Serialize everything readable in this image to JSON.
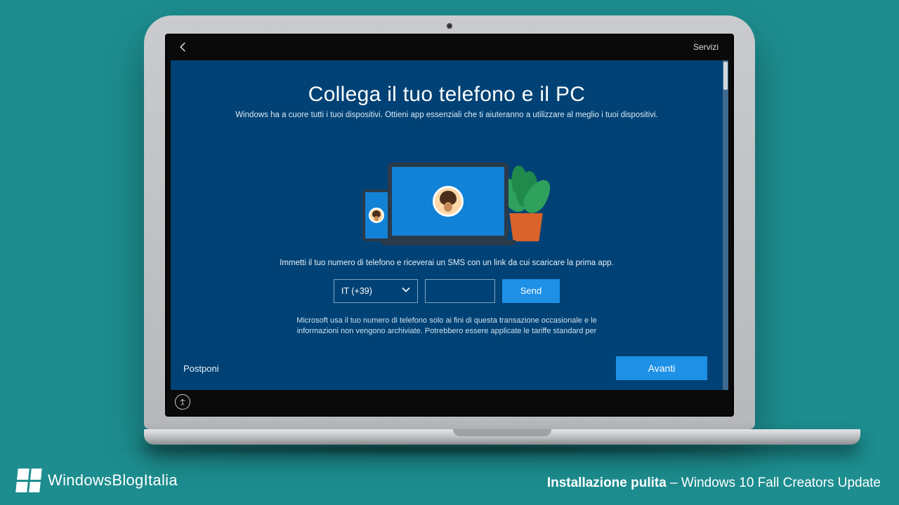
{
  "topbar": {
    "services": "Servizi"
  },
  "oobe": {
    "title": "Collega il tuo telefono e il PC",
    "subtitle": "Windows ha a cuore tutti i tuoi dispositivi. Ottieni app essenziali che ti aiuteranno a utilizzare al meglio i tuoi dispositivi.",
    "instruction": "Immetti il tuo numero di telefono e riceverai un SMS con un link da cui scaricare la prima app.",
    "country_selected": "IT (+39)",
    "phone_value": "",
    "send_label": "Send",
    "disclaimer": "Microsoft usa il tuo numero di telefono solo ai fini di questa transazione occasionale e le informazioni non vengono archiviate. Potrebbero essere applicate le tariffe standard per",
    "postpone_label": "Postponi",
    "next_label": "Avanti"
  },
  "branding": {
    "site_prefix": "Windows",
    "site_bold": "Blog",
    "site_suffix": "Italia",
    "caption_bold": "Installazione pulita",
    "caption_rest": " – Windows 10 Fall Creators Update"
  }
}
